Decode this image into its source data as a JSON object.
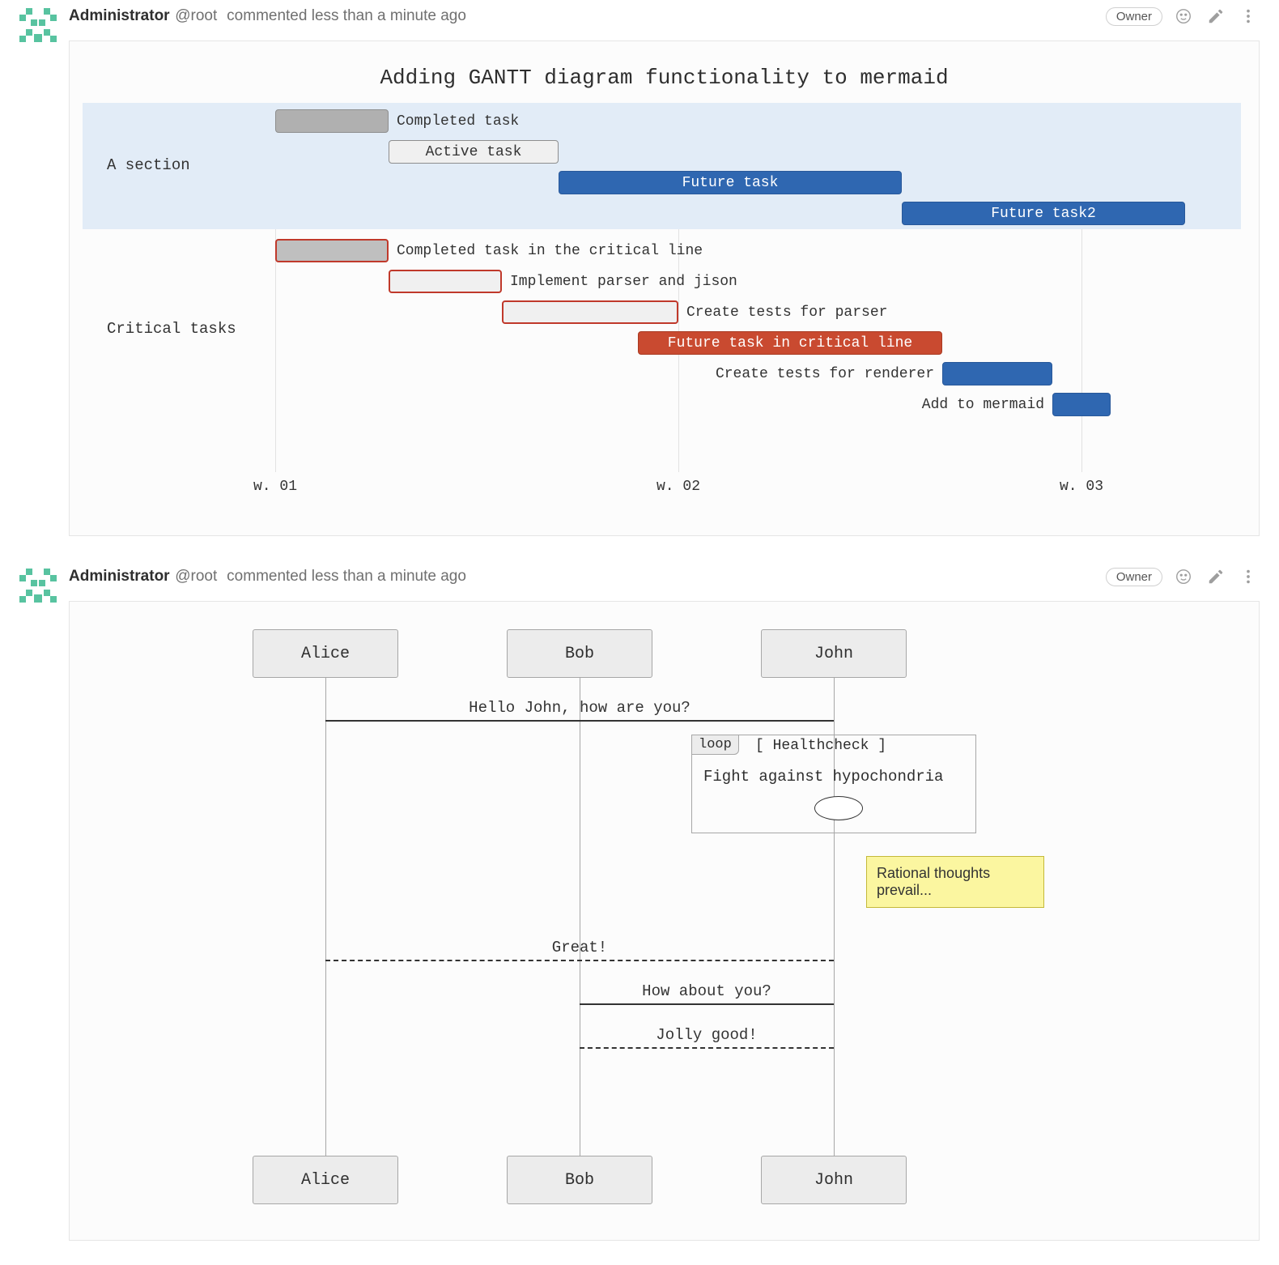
{
  "notes": [
    {
      "author": "Administrator",
      "handle": "@root",
      "action_text": "commented less than a minute ago",
      "badge": "Owner"
    },
    {
      "author": "Administrator",
      "handle": "@root",
      "action_text": "commented less than a minute ago",
      "badge": "Owner"
    }
  ],
  "gantt": {
    "title": "Adding GANTT diagram functionality to mermaid",
    "axis_ticks": [
      "w. 01",
      "w. 02",
      "w. 03"
    ],
    "sections": [
      {
        "name": "A section",
        "highlight": true
      },
      {
        "name": "Critical tasks",
        "highlight": false
      }
    ],
    "tasks": {
      "a1": "Completed task",
      "a2": "Active task",
      "a3": "Future task",
      "a4": "Future task2",
      "c1": "Completed task in the critical line",
      "c2": "Implement parser and jison",
      "c3": "Create tests for parser",
      "c4": "Future task in critical line",
      "c5": "Create tests for renderer",
      "c6": "Add to mermaid"
    }
  },
  "sequence": {
    "actors": [
      "Alice",
      "Bob",
      "John"
    ],
    "messages": {
      "m1": "Hello John, how are you?",
      "m2": "Great!",
      "m3": "How about you?",
      "m4": "Jolly good!"
    },
    "loop": {
      "tag": "loop",
      "condition": "[ Healthcheck ]",
      "body": "Fight against hypochondria"
    },
    "note": "Rational thoughts prevail..."
  },
  "chart_data": [
    {
      "type": "gantt",
      "title": "Adding GANTT diagram functionality to mermaid",
      "x_axis_ticks": [
        "w. 01",
        "w. 02",
        "w. 03"
      ],
      "sections": [
        {
          "name": "A section",
          "row_highlight": true,
          "tasks": [
            {
              "label": "Completed task",
              "status": "done",
              "critical": false,
              "start_tick": 0,
              "end_tick": 0.28
            },
            {
              "label": "Active task",
              "status": "active",
              "critical": false,
              "start_tick": 0.28,
              "end_tick": 0.7
            },
            {
              "label": "Future task",
              "status": "future",
              "critical": false,
              "start_tick": 0.7,
              "end_tick": 1.55
            },
            {
              "label": "Future task2",
              "status": "future",
              "critical": false,
              "start_tick": 1.55,
              "end_tick": 2.25
            }
          ]
        },
        {
          "name": "Critical tasks",
          "row_highlight": false,
          "tasks": [
            {
              "label": "Completed task in the critical line",
              "status": "done",
              "critical": true,
              "start_tick": 0,
              "end_tick": 0.28
            },
            {
              "label": "Implement parser and jison",
              "status": "active",
              "critical": true,
              "start_tick": 0.28,
              "end_tick": 0.56
            },
            {
              "label": "Create tests for parser",
              "status": "active",
              "critical": true,
              "start_tick": 0.56,
              "end_tick": 1.0
            },
            {
              "label": "Future task in critical line",
              "status": "future",
              "critical": true,
              "start_tick": 0.9,
              "end_tick": 1.65
            },
            {
              "label": "Create tests for renderer",
              "status": "future",
              "critical": false,
              "start_tick": 1.65,
              "end_tick": 1.92
            },
            {
              "label": "Add to mermaid",
              "status": "future",
              "critical": false,
              "start_tick": 1.92,
              "end_tick": 2.06
            }
          ]
        }
      ]
    },
    {
      "type": "sequence",
      "actors": [
        "Alice",
        "Bob",
        "John"
      ],
      "interactions": [
        {
          "from": "Alice",
          "to": "John",
          "text": "Hello John, how are you?",
          "style": "solid"
        },
        {
          "loop": {
            "condition": "Healthcheck",
            "text": "Fight against hypochondria",
            "over": [
              "Bob",
              "John"
            ]
          }
        },
        {
          "note": {
            "text": "Rational thoughts prevail...",
            "right_of": "John"
          }
        },
        {
          "from": "John",
          "to": "Alice",
          "text": "Great!",
          "style": "dashed"
        },
        {
          "from": "John",
          "to": "Bob",
          "text": "How about you?",
          "style": "solid"
        },
        {
          "from": "Bob",
          "to": "John",
          "text": "Jolly good!",
          "style": "dashed"
        }
      ]
    }
  ]
}
